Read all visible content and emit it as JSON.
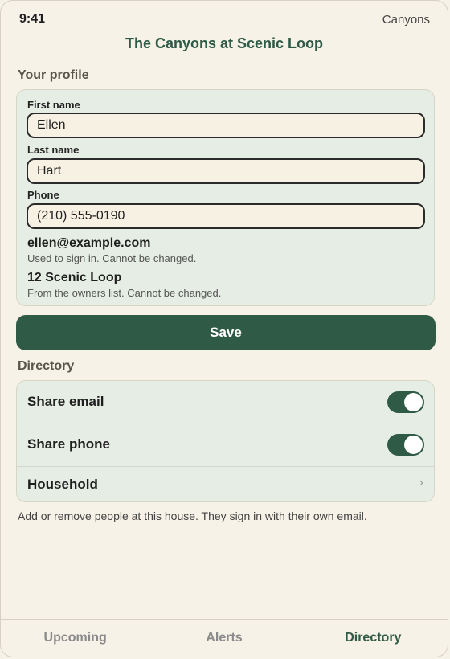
{
  "status_bar": {
    "time": "9:41",
    "right_label": "Canyons"
  },
  "header": {
    "title": "The Canyons at Scenic Loop"
  },
  "profile": {
    "section_title": "Your profile",
    "first_name": {
      "label": "First name",
      "value": "Ellen"
    },
    "last_name": {
      "label": "Last name",
      "value": "Hart"
    },
    "phone": {
      "label": "Phone",
      "value": "(210) 555-0190"
    },
    "email": {
      "value": "ellen@example.com",
      "note": "Used to sign in. Cannot be changed."
    },
    "address": {
      "value": "12 Scenic Loop",
      "note": "From the owners list. Cannot be changed."
    }
  },
  "save_label": "Save",
  "directory": {
    "section_title": "Directory",
    "share_email": {
      "label": "Share email",
      "on": true
    },
    "share_phone": {
      "label": "Share phone",
      "on": true
    },
    "household": {
      "label": "Household",
      "chevron": "›"
    },
    "helper": "Add or remove people at this house. They sign in with their own email."
  },
  "tabs": [
    {
      "label": "Upcoming",
      "active": false
    },
    {
      "label": "Alerts",
      "active": false
    },
    {
      "label": "Directory",
      "active": true
    }
  ],
  "colors": {
    "accent": "#2e5a46",
    "background": "#f6f2e7",
    "card": "#e6ede4",
    "input": "#f7f1e3"
  },
  "icons": {
    "household_chevron": "chevron-right-icon",
    "toggle": "toggle-switch"
  }
}
